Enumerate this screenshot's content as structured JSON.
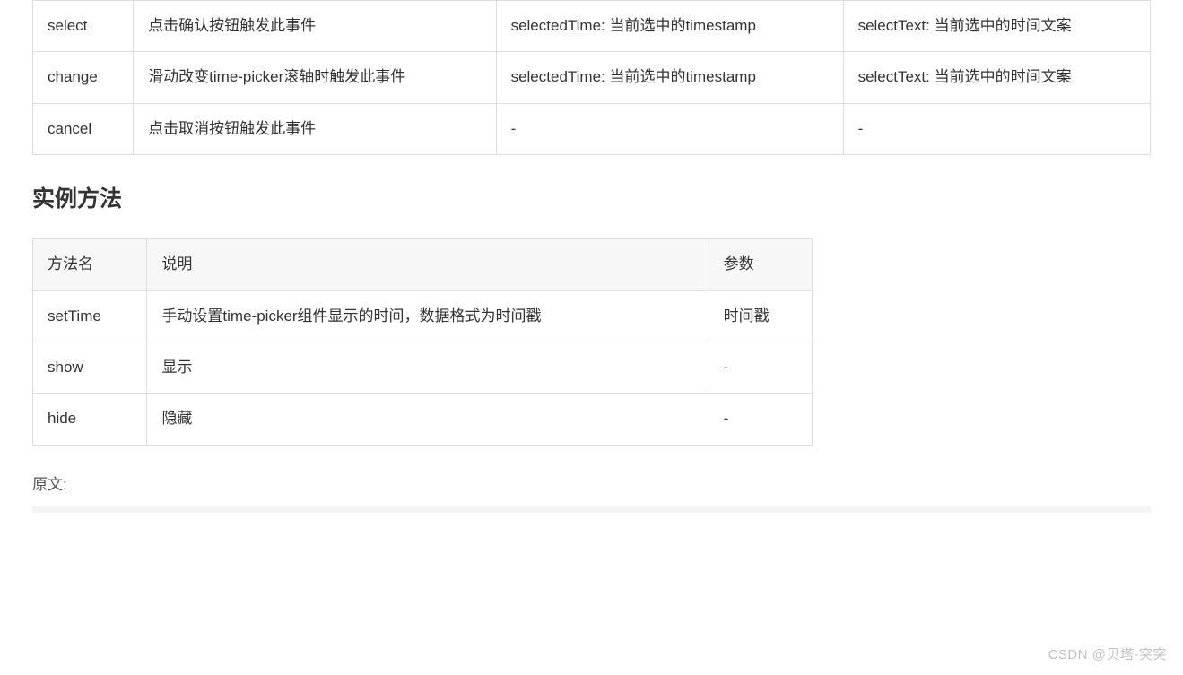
{
  "eventsTable": {
    "rows": [
      {
        "name": "select",
        "desc": "点击确认按钮触发此事件",
        "arg1": "selectedTime: 当前选中的timestamp",
        "arg2": "selectText: 当前选中的时间文案"
      },
      {
        "name": "change",
        "desc": "滑动改变time-picker滚轴时触发此事件",
        "arg1": "selectedTime: 当前选中的timestamp",
        "arg2": "selectText: 当前选中的时间文案"
      },
      {
        "name": "cancel",
        "desc": "点击取消按钮触发此事件",
        "arg1": "-",
        "arg2": "-"
      }
    ]
  },
  "methodsSection": {
    "heading": "实例方法",
    "headers": {
      "name": "方法名",
      "desc": "说明",
      "params": "参数"
    },
    "rows": [
      {
        "name": "setTime",
        "desc": "手动设置time-picker组件显示的时间，数据格式为时间戳",
        "params": "时间戳"
      },
      {
        "name": "show",
        "desc": "显示",
        "params": "-"
      },
      {
        "name": "hide",
        "desc": "隐藏",
        "params": "-"
      }
    ]
  },
  "sourceLabel": "原文:",
  "watermark": "CSDN @贝塔-突突"
}
